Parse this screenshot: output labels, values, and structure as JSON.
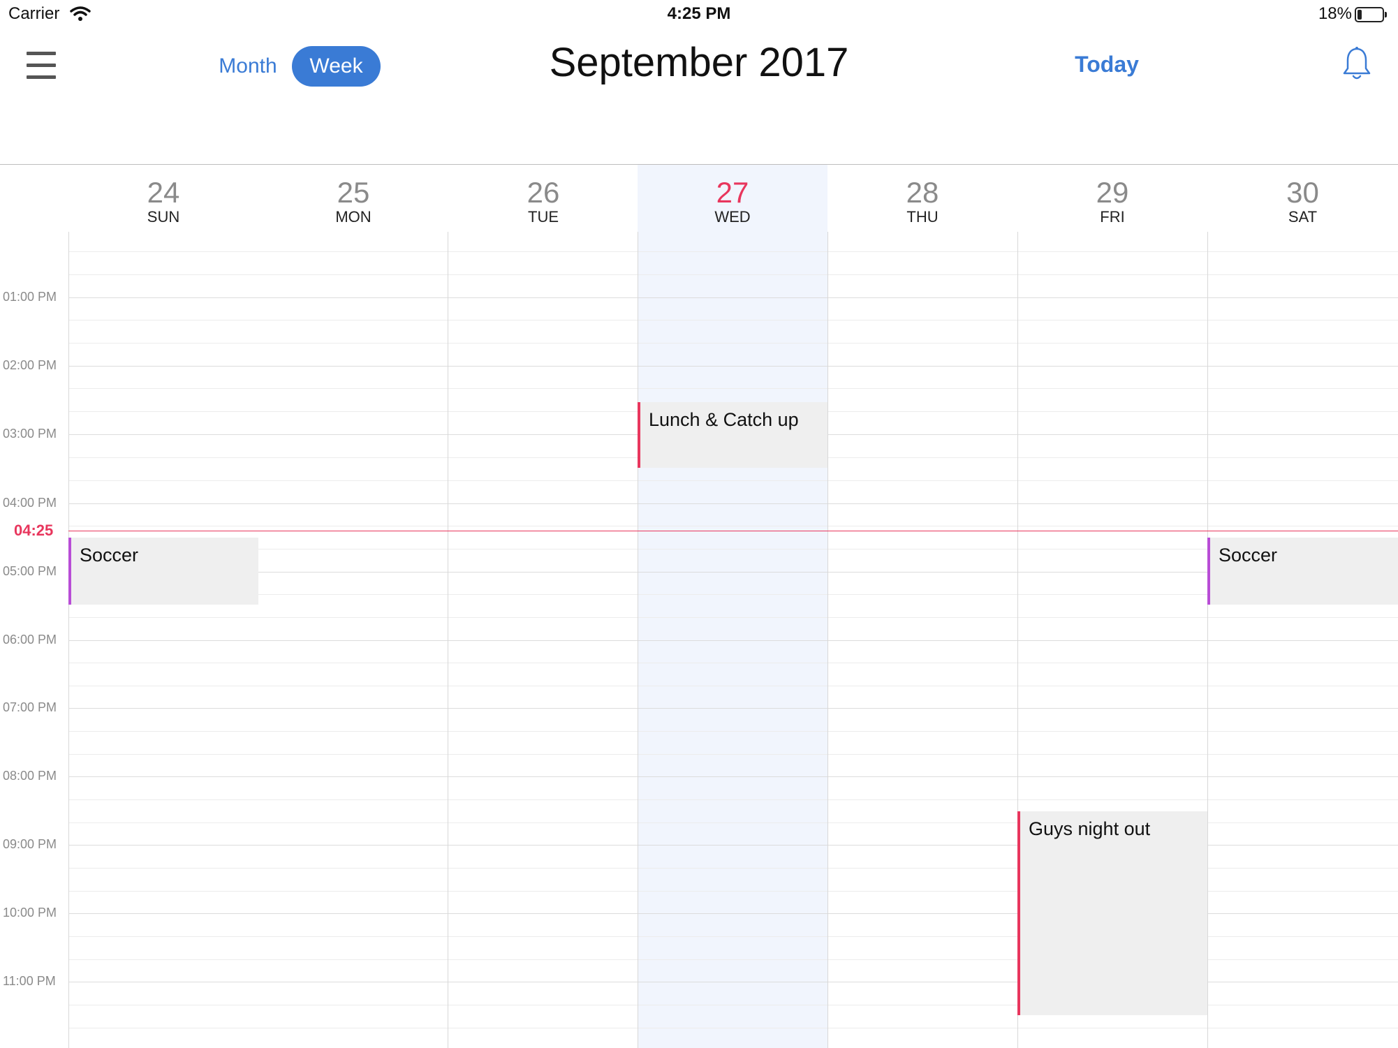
{
  "status_bar": {
    "carrier": "Carrier",
    "time": "4:25 PM",
    "battery": "18%"
  },
  "header": {
    "month_label": "Month",
    "week_label": "Week",
    "title": "September 2017",
    "today_label": "Today"
  },
  "days": [
    {
      "num": "24",
      "wd": "SUN"
    },
    {
      "num": "25",
      "wd": "MON"
    },
    {
      "num": "26",
      "wd": "TUE"
    },
    {
      "num": "27",
      "wd": "WED"
    },
    {
      "num": "28",
      "wd": "THU"
    },
    {
      "num": "29",
      "wd": "FRI"
    },
    {
      "num": "30",
      "wd": "SAT"
    }
  ],
  "time_labels": [
    "01:00 PM",
    "02:00 PM",
    "03:00 PM",
    "04:00 PM",
    "05:00 PM",
    "06:00 PM",
    "07:00 PM",
    "08:00 PM",
    "09:00 PM",
    "10:00 PM",
    "11:00 PM"
  ],
  "now_label": "04:25",
  "events": [
    {
      "title": "Lunch & Catch up",
      "day": "WED",
      "start": "02:45 PM",
      "end": "03:30 PM"
    },
    {
      "title": "Soccer",
      "day": "SUN",
      "start": "04:30 PM",
      "end": "05:30 PM"
    },
    {
      "title": "Soccer",
      "day": "SAT",
      "start": "04:30 PM",
      "end": "05:30 PM"
    },
    {
      "title": "Guys night out",
      "day": "FRI",
      "start": "08:30 PM",
      "end": "11:30 PM"
    }
  ],
  "colors": {
    "accent": "#3a7bd5",
    "today": "#e8365d",
    "event_purple": "#b84dd6"
  }
}
